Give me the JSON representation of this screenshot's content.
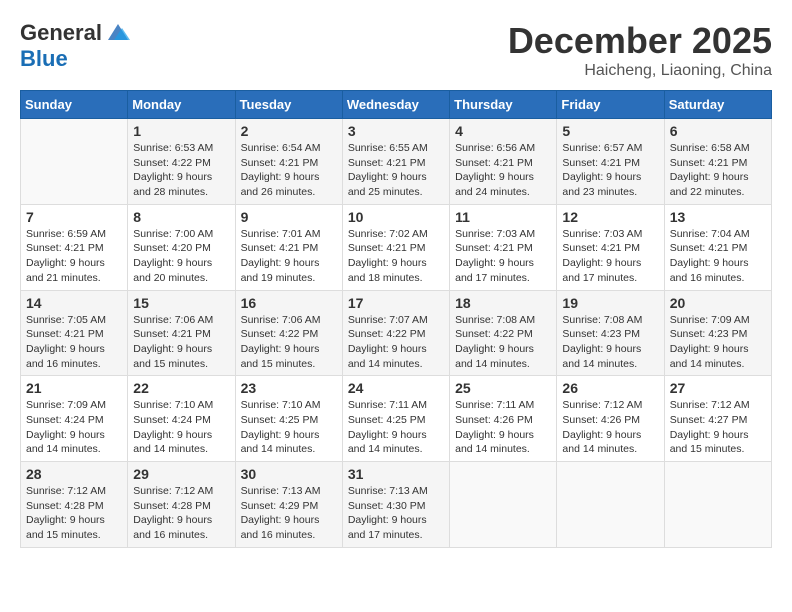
{
  "header": {
    "logo_general": "General",
    "logo_blue": "Blue",
    "month": "December 2025",
    "location": "Haicheng, Liaoning, China"
  },
  "days_of_week": [
    "Sunday",
    "Monday",
    "Tuesday",
    "Wednesday",
    "Thursday",
    "Friday",
    "Saturday"
  ],
  "weeks": [
    [
      {
        "day": "",
        "info": ""
      },
      {
        "day": "1",
        "info": "Sunrise: 6:53 AM\nSunset: 4:22 PM\nDaylight: 9 hours\nand 28 minutes."
      },
      {
        "day": "2",
        "info": "Sunrise: 6:54 AM\nSunset: 4:21 PM\nDaylight: 9 hours\nand 26 minutes."
      },
      {
        "day": "3",
        "info": "Sunrise: 6:55 AM\nSunset: 4:21 PM\nDaylight: 9 hours\nand 25 minutes."
      },
      {
        "day": "4",
        "info": "Sunrise: 6:56 AM\nSunset: 4:21 PM\nDaylight: 9 hours\nand 24 minutes."
      },
      {
        "day": "5",
        "info": "Sunrise: 6:57 AM\nSunset: 4:21 PM\nDaylight: 9 hours\nand 23 minutes."
      },
      {
        "day": "6",
        "info": "Sunrise: 6:58 AM\nSunset: 4:21 PM\nDaylight: 9 hours\nand 22 minutes."
      }
    ],
    [
      {
        "day": "7",
        "info": "Sunrise: 6:59 AM\nSunset: 4:21 PM\nDaylight: 9 hours\nand 21 minutes."
      },
      {
        "day": "8",
        "info": "Sunrise: 7:00 AM\nSunset: 4:20 PM\nDaylight: 9 hours\nand 20 minutes."
      },
      {
        "day": "9",
        "info": "Sunrise: 7:01 AM\nSunset: 4:21 PM\nDaylight: 9 hours\nand 19 minutes."
      },
      {
        "day": "10",
        "info": "Sunrise: 7:02 AM\nSunset: 4:21 PM\nDaylight: 9 hours\nand 18 minutes."
      },
      {
        "day": "11",
        "info": "Sunrise: 7:03 AM\nSunset: 4:21 PM\nDaylight: 9 hours\nand 17 minutes."
      },
      {
        "day": "12",
        "info": "Sunrise: 7:03 AM\nSunset: 4:21 PM\nDaylight: 9 hours\nand 17 minutes."
      },
      {
        "day": "13",
        "info": "Sunrise: 7:04 AM\nSunset: 4:21 PM\nDaylight: 9 hours\nand 16 minutes."
      }
    ],
    [
      {
        "day": "14",
        "info": "Sunrise: 7:05 AM\nSunset: 4:21 PM\nDaylight: 9 hours\nand 16 minutes."
      },
      {
        "day": "15",
        "info": "Sunrise: 7:06 AM\nSunset: 4:21 PM\nDaylight: 9 hours\nand 15 minutes."
      },
      {
        "day": "16",
        "info": "Sunrise: 7:06 AM\nSunset: 4:22 PM\nDaylight: 9 hours\nand 15 minutes."
      },
      {
        "day": "17",
        "info": "Sunrise: 7:07 AM\nSunset: 4:22 PM\nDaylight: 9 hours\nand 14 minutes."
      },
      {
        "day": "18",
        "info": "Sunrise: 7:08 AM\nSunset: 4:22 PM\nDaylight: 9 hours\nand 14 minutes."
      },
      {
        "day": "19",
        "info": "Sunrise: 7:08 AM\nSunset: 4:23 PM\nDaylight: 9 hours\nand 14 minutes."
      },
      {
        "day": "20",
        "info": "Sunrise: 7:09 AM\nSunset: 4:23 PM\nDaylight: 9 hours\nand 14 minutes."
      }
    ],
    [
      {
        "day": "21",
        "info": "Sunrise: 7:09 AM\nSunset: 4:24 PM\nDaylight: 9 hours\nand 14 minutes."
      },
      {
        "day": "22",
        "info": "Sunrise: 7:10 AM\nSunset: 4:24 PM\nDaylight: 9 hours\nand 14 minutes."
      },
      {
        "day": "23",
        "info": "Sunrise: 7:10 AM\nSunset: 4:25 PM\nDaylight: 9 hours\nand 14 minutes."
      },
      {
        "day": "24",
        "info": "Sunrise: 7:11 AM\nSunset: 4:25 PM\nDaylight: 9 hours\nand 14 minutes."
      },
      {
        "day": "25",
        "info": "Sunrise: 7:11 AM\nSunset: 4:26 PM\nDaylight: 9 hours\nand 14 minutes."
      },
      {
        "day": "26",
        "info": "Sunrise: 7:12 AM\nSunset: 4:26 PM\nDaylight: 9 hours\nand 14 minutes."
      },
      {
        "day": "27",
        "info": "Sunrise: 7:12 AM\nSunset: 4:27 PM\nDaylight: 9 hours\nand 15 minutes."
      }
    ],
    [
      {
        "day": "28",
        "info": "Sunrise: 7:12 AM\nSunset: 4:28 PM\nDaylight: 9 hours\nand 15 minutes."
      },
      {
        "day": "29",
        "info": "Sunrise: 7:12 AM\nSunset: 4:28 PM\nDaylight: 9 hours\nand 16 minutes."
      },
      {
        "day": "30",
        "info": "Sunrise: 7:13 AM\nSunset: 4:29 PM\nDaylight: 9 hours\nand 16 minutes."
      },
      {
        "day": "31",
        "info": "Sunrise: 7:13 AM\nSunset: 4:30 PM\nDaylight: 9 hours\nand 17 minutes."
      },
      {
        "day": "",
        "info": ""
      },
      {
        "day": "",
        "info": ""
      },
      {
        "day": "",
        "info": ""
      }
    ]
  ]
}
